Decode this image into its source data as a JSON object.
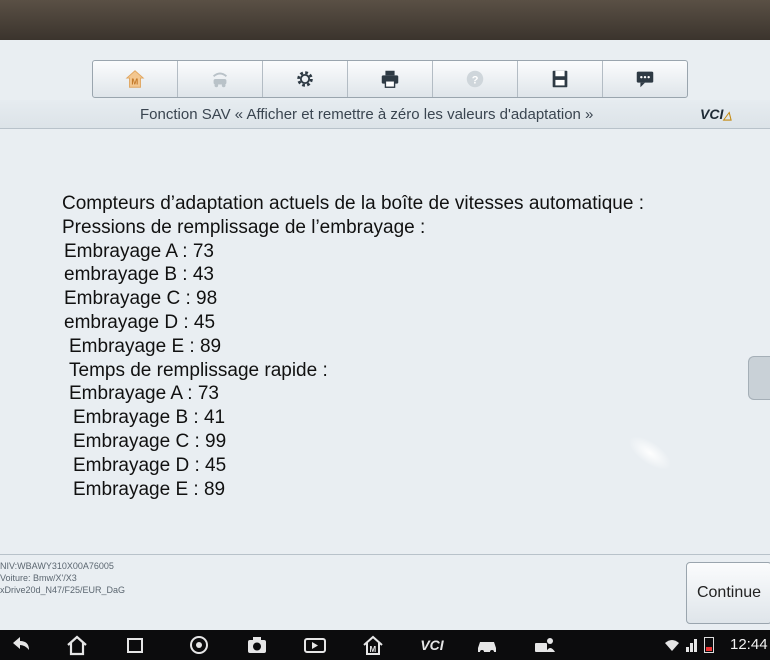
{
  "toolbar": {
    "buttons": [
      {
        "icon": "home-icon",
        "enabled": false
      },
      {
        "icon": "vehicle-swap-icon",
        "enabled": false
      },
      {
        "icon": "gear-icon",
        "enabled": true
      },
      {
        "icon": "printer-icon",
        "enabled": true
      },
      {
        "icon": "help-icon",
        "enabled": false
      },
      {
        "icon": "save-icon",
        "enabled": true
      },
      {
        "icon": "chat-icon",
        "enabled": true
      }
    ]
  },
  "header": {
    "title": "Fonction SAV « Afficher et remettre à zéro les valeurs d'adaptation »",
    "vci_label": "VCI"
  },
  "content": {
    "heading": "Compteurs d’adaptation actuels de la boîte de vitesses automatique :",
    "section1_title": "Pressions de remplissage de l’embrayage :",
    "section1_items": [
      "Embrayage A : 73",
      "embrayage B : 43",
      "Embrayage C : 98",
      "embrayage D : 45",
      "Embrayage E : 89"
    ],
    "section2_title": "Temps de remplissage rapide :",
    "section2_items": [
      "Embrayage A : 73",
      "Embrayage B : 41",
      "Embrayage C : 99",
      "Embrayage D : 45",
      "Embrayage E : 89"
    ]
  },
  "vehicle": {
    "vin": "NIV:WBAWY310X00A76005",
    "car": "Voiture: Bmw/X'/X3",
    "engine": "xDrive20d_N47/F25/EUR_DaG"
  },
  "actions": {
    "continue_label": "Continue"
  },
  "navbar": {
    "vci_label": "VCI",
    "time": "12:44"
  }
}
